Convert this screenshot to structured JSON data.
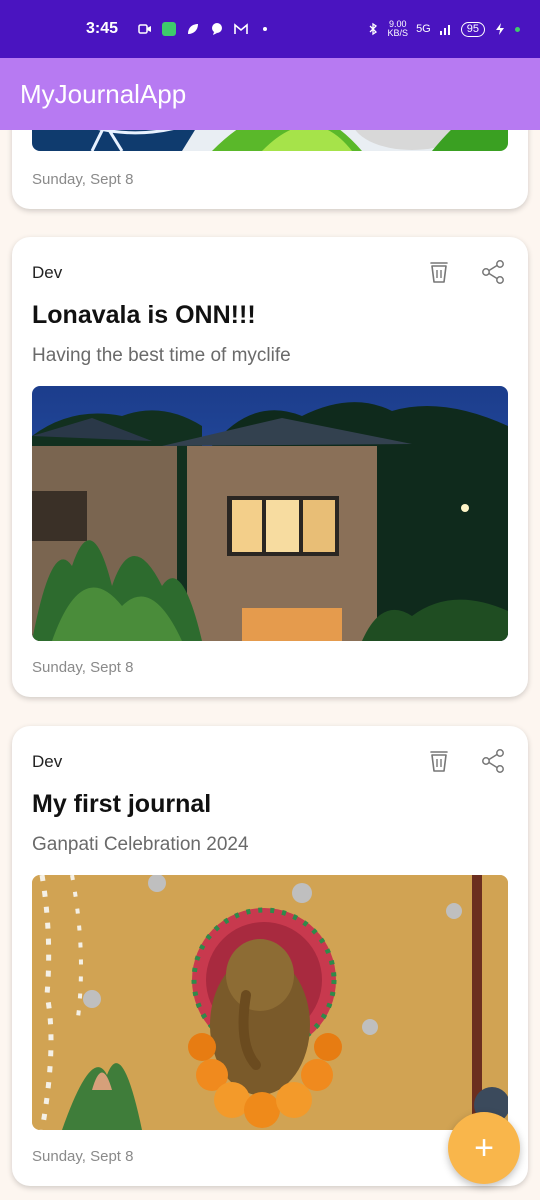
{
  "status_bar": {
    "time": "3:45",
    "net_speed_value": "9.00",
    "net_speed_unit": "KB/S",
    "network": "5G",
    "battery": "95"
  },
  "app_bar": {
    "title": "MyJournalApp"
  },
  "feed": {
    "top_card": {
      "date": "Sunday, Sept 8"
    },
    "cards": [
      {
        "author": "Dev",
        "title": "Lonavala is ONN!!!",
        "description": "Having the best time of myclife",
        "date": "Sunday, Sept 8",
        "image_icon": "villa-night-photo"
      },
      {
        "author": "Dev",
        "title": "My first journal",
        "description": "Ganpati Celebration 2024",
        "date": "Sunday, Sept 8",
        "image_icon": "ganpati-idol-photo"
      }
    ]
  },
  "fab": {
    "label": "+"
  },
  "colors": {
    "status_bar": "#4a14c0",
    "app_bar": "#b77af2",
    "fab": "#f9b64b",
    "background": "#fdf6f0"
  }
}
